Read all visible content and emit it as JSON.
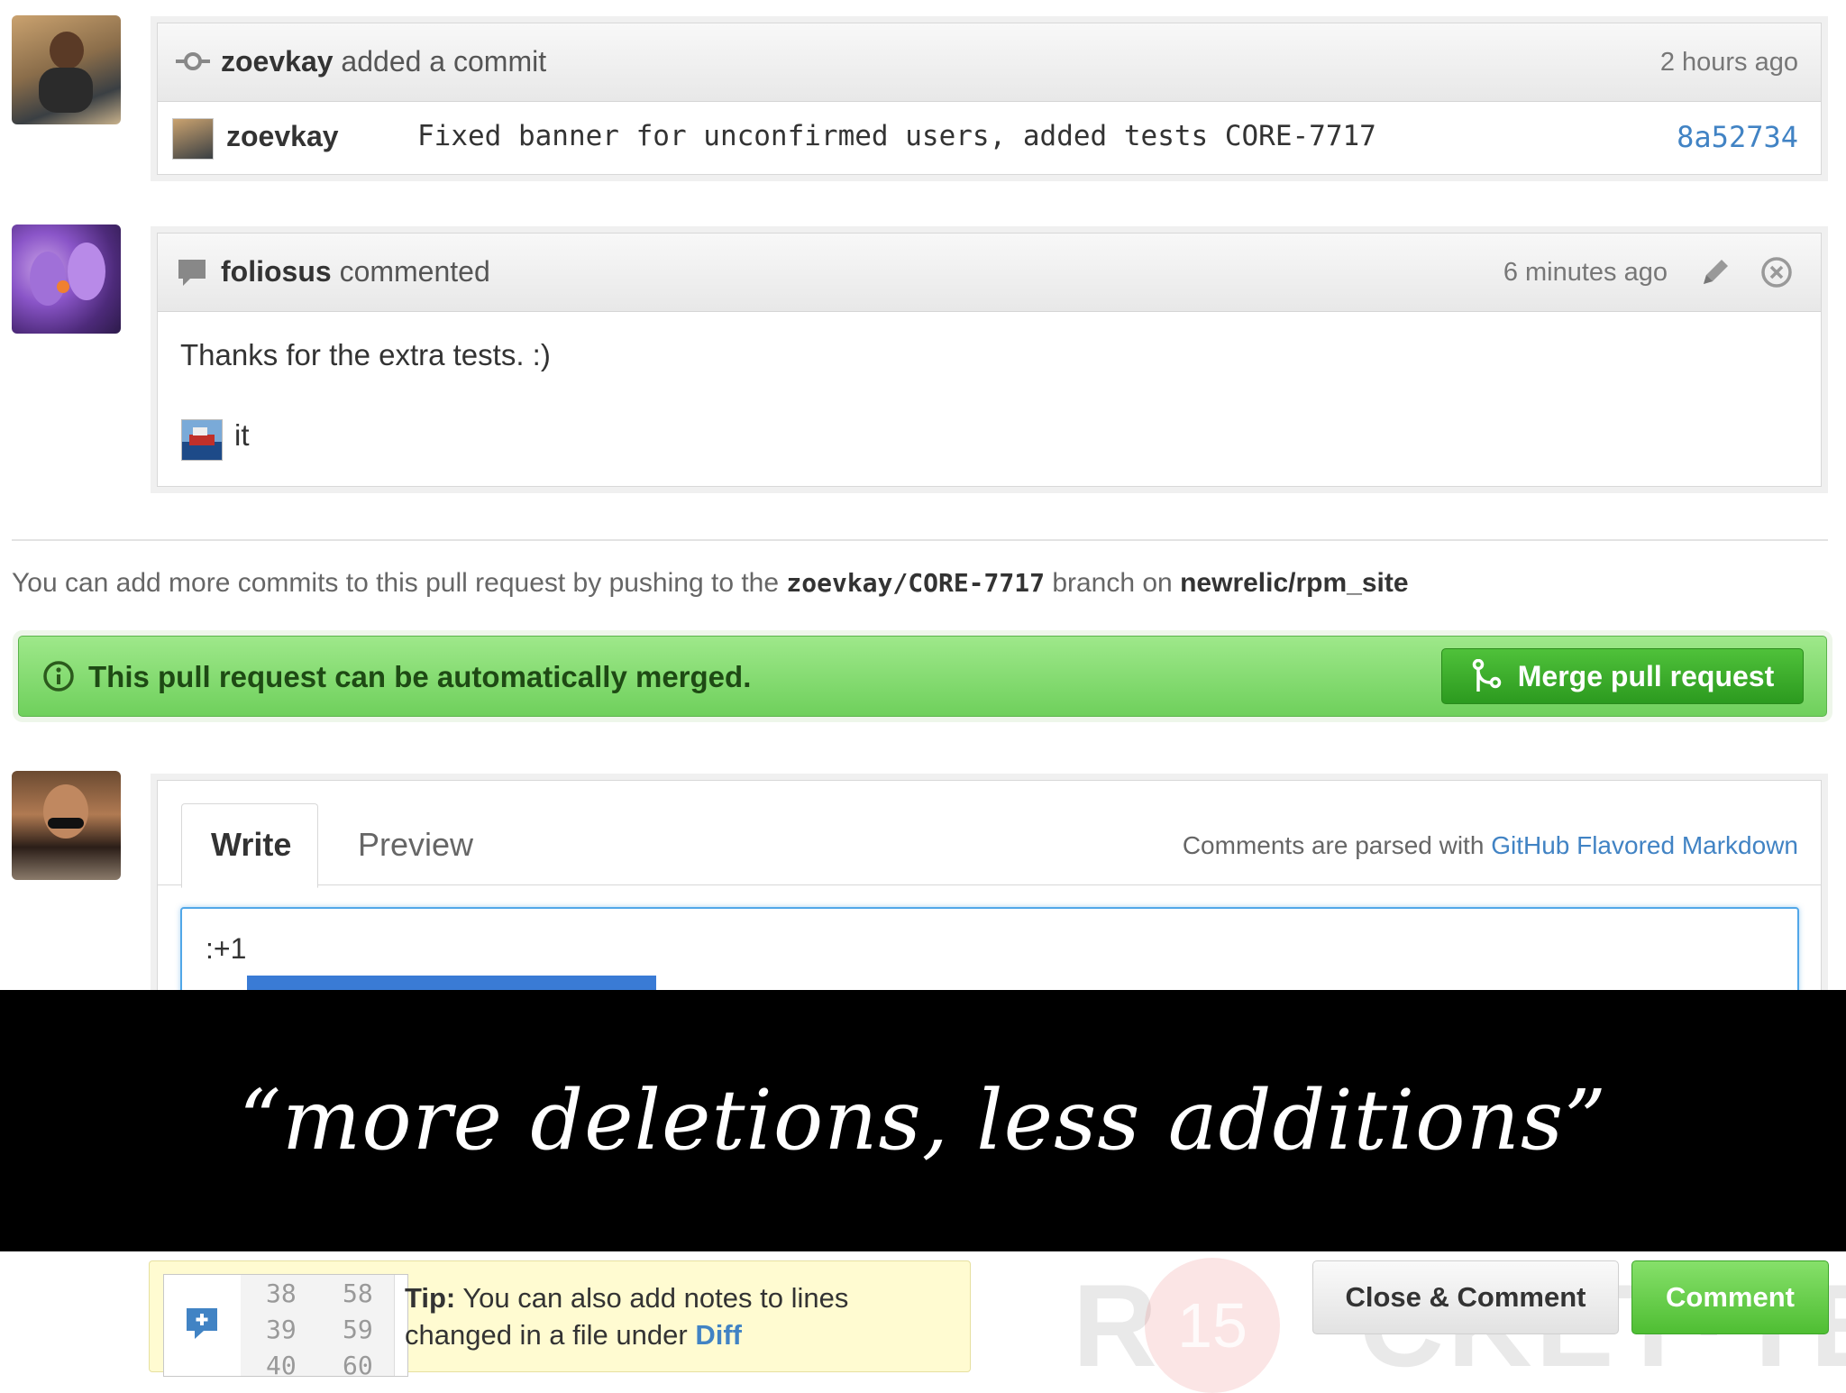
{
  "commit_event": {
    "user": "zoevkay",
    "action": "added a commit",
    "time": "2 hours ago",
    "commit_author": "zoevkay",
    "commit_message": "Fixed banner for unconfirmed users, added tests CORE-7717",
    "commit_sha": "8a52734"
  },
  "comment_event": {
    "user": "foliosus",
    "action": "commented",
    "time": "6 minutes ago",
    "body": "Thanks for the extra tests. :)",
    "emoji_caption": "it"
  },
  "push_note": {
    "prefix": "You can add more commits to this pull request by pushing to the",
    "branch": "zoevkay/CORE-7717",
    "middle": "branch on",
    "repo": "newrelic/rpm_site"
  },
  "merge": {
    "status": "This pull request can be automatically merged.",
    "button": "Merge pull request",
    "colors": {
      "bar": "#7ed86a",
      "button": "#34a326"
    }
  },
  "composer": {
    "tabs": [
      "Write",
      "Preview"
    ],
    "hint_prefix": "Comments are parsed with",
    "hint_link": "GitHub Flavored Markdown",
    "textarea_value": ":+1"
  },
  "banner_quote": "“more deletions, less additions”",
  "tip": {
    "bold": "Tip:",
    "line1": "You can also add notes to lines",
    "line2_prefix": "changed in a file under",
    "line2_link": "Diff",
    "left_numbers": [
      "38",
      "39",
      "40"
    ],
    "right_numbers": [
      "58",
      "59",
      "60"
    ]
  },
  "actions": {
    "close_comment": "Close & Comment",
    "comment": "Comment"
  },
  "watermark": {
    "left": "R",
    "circle": "15",
    "right": "CKET·TECH"
  }
}
